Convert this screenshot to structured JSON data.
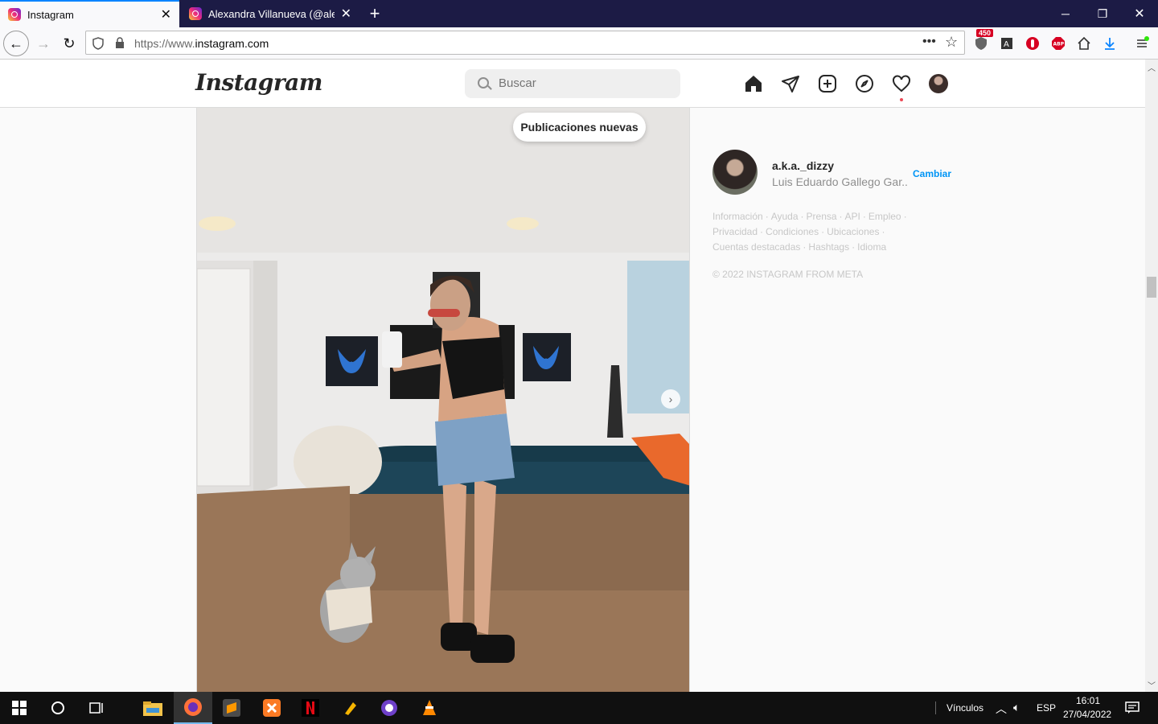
{
  "browser": {
    "tabs": [
      {
        "title": "Instagram",
        "active": true
      },
      {
        "title": "Alexandra Villanueva (@alemiz",
        "active": false
      }
    ],
    "url_prefix": "https://www.",
    "url_host": "instagram.com",
    "ext_badge": "450",
    "abp_label": "ABP"
  },
  "header": {
    "logo": "Instagram",
    "search_placeholder": "Buscar"
  },
  "feed": {
    "new_posts_label": "Publicaciones nuevas"
  },
  "sidebar": {
    "username": "a.k.a._dizzy",
    "full_name": "Luis Eduardo Gallego Gar...",
    "switch_label": "Cambiar",
    "footer_links": [
      "Información",
      "Ayuda",
      "Prensa",
      "API",
      "Empleo",
      "Privacidad",
      "Condiciones",
      "Ubicaciones",
      "Cuentas destacadas",
      "Hashtags",
      "Idioma"
    ],
    "copyright": "© 2022 INSTAGRAM FROM META"
  },
  "taskbar": {
    "links_label": "Vínculos",
    "language": "ESP",
    "time": "16:01",
    "date": "27/04/2022"
  },
  "colors": {
    "accent_blue": "#0095f6",
    "browser_frame": "#1c1b45",
    "notification_red": "#ed4956"
  }
}
